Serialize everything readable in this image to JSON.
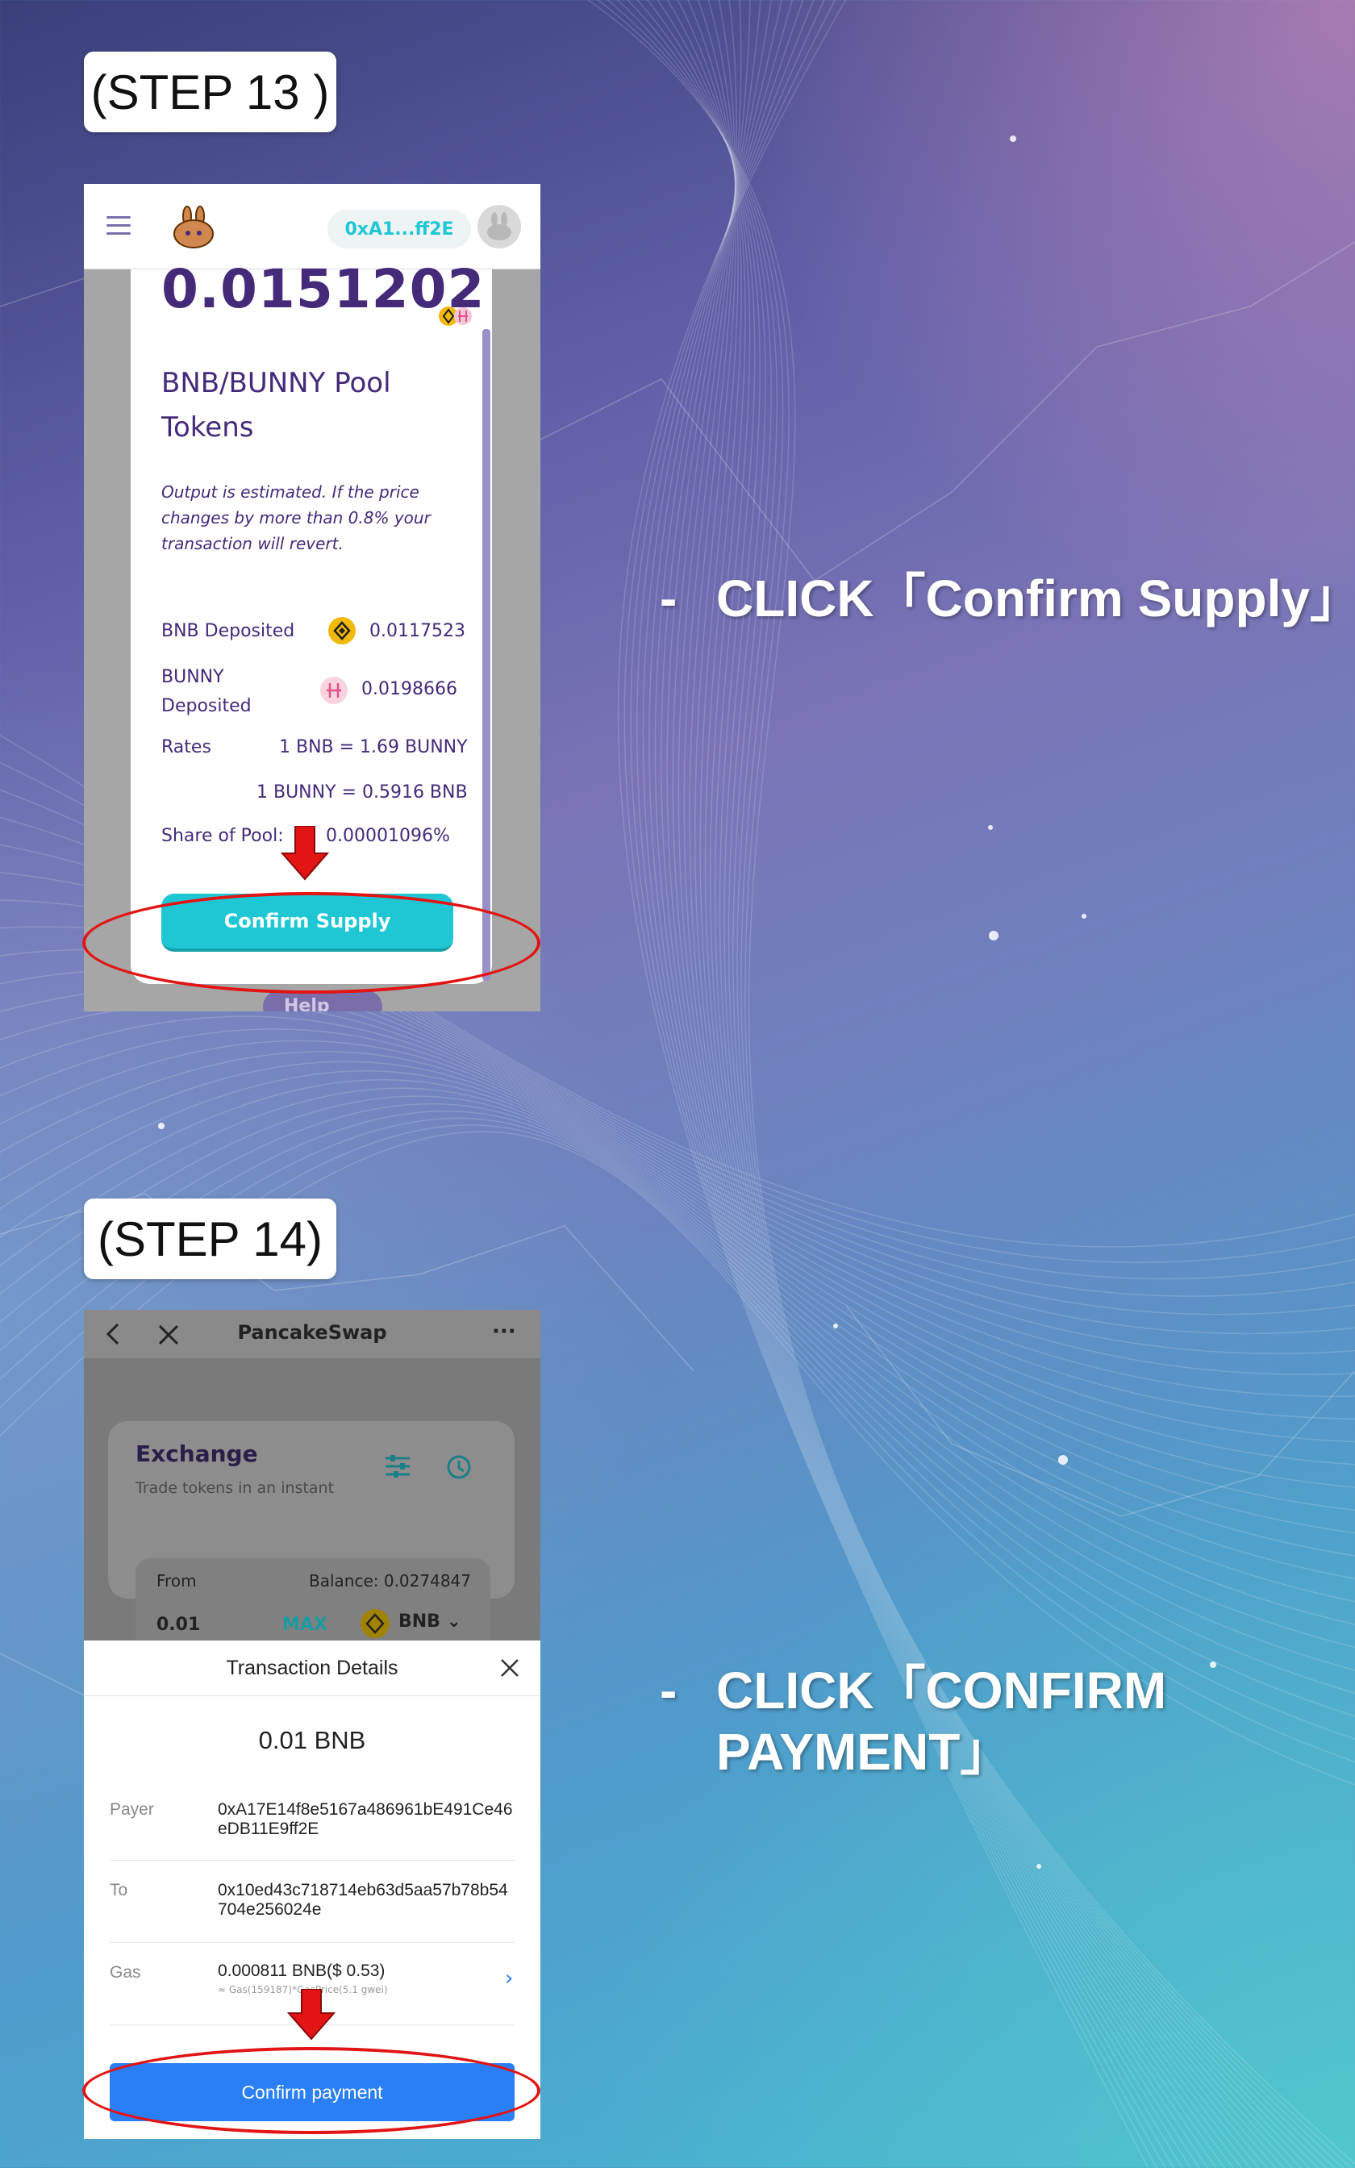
{
  "step13": {
    "tag": "(STEP 13 )",
    "instruction": "CLICK「Confirm Supply」",
    "dash": "-",
    "wallet_address": "0xA1...ff2E",
    "pool_amount": "0.0151202",
    "pool_token_name": "BNB/BUNNY Pool Tokens",
    "estimate_note": "Output is estimated. If the price changes by more than 0.8% your transaction will revert.",
    "rows": {
      "bnb_deposited_label": "BNB Deposited",
      "bnb_deposited_value": "0.0117523",
      "bunny_deposited_label": "BUNNY Deposited",
      "bunny_deposited_value": "0.0198666",
      "rates_label": "Rates",
      "rate1": "1 BNB = 1.69 BUNNY",
      "rate2": "1 BUNNY = 0.5916 BNB",
      "share_label": "Share of Pool:",
      "share_value": "0.00001096%"
    },
    "confirm_button": "Confirm Supply",
    "help_button": "Help"
  },
  "step14": {
    "tag": "(STEP 14)",
    "instruction_line1": "CLICK「CONFIRM",
    "instruction_line2": "PAYMENT」",
    "dash": "-",
    "nav_title": "PancakeSwap",
    "nav_more": "···",
    "exchange_title": "Exchange",
    "exchange_subtitle": "Trade tokens in an instant",
    "from_label": "From",
    "balance": "Balance: 0.0274847",
    "from_amount": "0.01",
    "max_label": "MAX",
    "token": "BNB",
    "sheet_title": "Transaction Details",
    "amount": "0.01 BNB",
    "payer_label": "Payer",
    "payer_value": "0xA17E14f8e5167a486961bE491Ce46eDB11E9ff2E",
    "to_label": "To",
    "to_value": "0x10ed43c718714eb63d5aa57b78b54704e256024e",
    "gas_label": "Gas",
    "gas_value": "0.000811 BNB($ 0.53)",
    "gas_detail": "≈ Gas(159187)*GasPrice(5.1 gwei)",
    "confirm_button": "Confirm payment"
  },
  "colors": {
    "pancake_teal": "#1fc7d4",
    "pancake_purple": "#452a7a",
    "bnb_yellow": "#f0b90b",
    "pay_blue": "#2a7ff6",
    "highlight_red": "#e21414"
  }
}
